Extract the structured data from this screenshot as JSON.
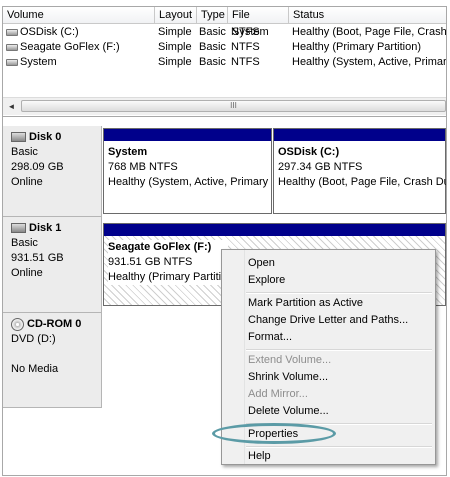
{
  "columns": [
    "Volume",
    "Layout",
    "Type",
    "File System",
    "Status"
  ],
  "volumes": [
    {
      "name": "OSDisk (C:)",
      "layout": "Simple",
      "type": "Basic",
      "fs": "NTFS",
      "status": "Healthy (Boot, Page File, Crash D"
    },
    {
      "name": "Seagate GoFlex (F:)",
      "layout": "Simple",
      "type": "Basic",
      "fs": "NTFS",
      "status": "Healthy (Primary Partition)"
    },
    {
      "name": "System",
      "layout": "Simple",
      "type": "Basic",
      "fs": "NTFS",
      "status": "Healthy (System, Active, Primary"
    }
  ],
  "scrollbar": {
    "left_arrow": "◄",
    "grip": "III"
  },
  "disks": [
    {
      "name": "Disk 0",
      "type": "Basic",
      "size": "298.09 GB",
      "state": "Online"
    },
    {
      "name": "Disk 1",
      "type": "Basic",
      "size": "931.51 GB",
      "state": "Online"
    },
    {
      "name": "CD-ROM 0",
      "type": "DVD (D:)",
      "size": "",
      "state": "No Media"
    }
  ],
  "partitions": {
    "system": {
      "title": "System",
      "size": "768 MB NTFS",
      "status": "Healthy (System, Active, Primary F"
    },
    "osdisk": {
      "title": "OSDisk  (C:)",
      "size": "297.34 GB NTFS",
      "status": "Healthy (Boot, Page File, Crash Dum"
    },
    "seagate": {
      "title": "Seagate GoFlex  (F:)",
      "size": "931.51 GB NTFS",
      "status": "Healthy (Primary Partitio"
    }
  },
  "menu": {
    "open": "Open",
    "explore": "Explore",
    "mark_active": "Mark Partition as Active",
    "change_letter": "Change Drive Letter and Paths...",
    "format": "Format...",
    "extend": "Extend Volume...",
    "shrink": "Shrink Volume...",
    "add_mirror": "Add Mirror...",
    "delete": "Delete Volume...",
    "properties": "Properties",
    "help": "Help"
  },
  "colors": {
    "partition_bar": "#00008b",
    "highlight_oval": "#5b9ba6"
  }
}
